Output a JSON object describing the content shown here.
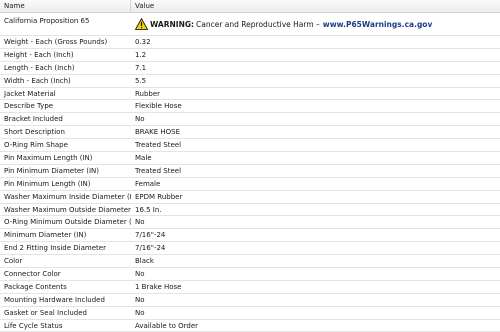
{
  "header": {
    "name": "Name",
    "value": "Value"
  },
  "prop65": {
    "name": "California Proposition 65",
    "warning_label": "WARNING:",
    "warning_text": "Cancer and Reproductive Harm –",
    "warning_link": "www.P65Warnings.ca.gov"
  },
  "rows": [
    {
      "name": "Weight - Each (Gross Pounds)",
      "value": "0.32"
    },
    {
      "name": "Height - Each (Inch)",
      "value": "1.2"
    },
    {
      "name": "Length - Each (Inch)",
      "value": "7.1"
    },
    {
      "name": "Width - Each (Inch)",
      "value": "5.5"
    },
    {
      "name": "Jacket Material",
      "value": "Rubber"
    },
    {
      "name": "Describe Type",
      "value": "Flexible Hose"
    },
    {
      "name": "Bracket Included",
      "value": "No"
    },
    {
      "name": "Short Description",
      "value": "BRAKE HOSE"
    },
    {
      "name": "O-Ring Rim Shape",
      "value": "Treated Steel"
    },
    {
      "name": "Pin Maximum Length (IN)",
      "value": "Male"
    },
    {
      "name": "Pin Minimum Diameter (IN)",
      "value": "Treated Steel"
    },
    {
      "name": "Pin Minimum Length (IN)",
      "value": "Female"
    },
    {
      "name": "Washer Maximum Inside Diameter (I...",
      "value": "EPDM Rubber"
    },
    {
      "name": "Washer Maximum Outside Diameter ...",
      "value": "16.5 In."
    },
    {
      "name": "O-Ring Minimum Outside Diameter (...",
      "value": "No"
    },
    {
      "name": "Minimum Diameter (IN)",
      "value": "7/16\"-24"
    },
    {
      "name": "End 2 Fitting Inside Diameter",
      "value": "7/16\"-24"
    },
    {
      "name": "Color",
      "value": "Black"
    },
    {
      "name": "Connector Color",
      "value": "No"
    },
    {
      "name": "Package Contents",
      "value": "1 Brake Hose"
    },
    {
      "name": "Mounting Hardware Included",
      "value": "No"
    },
    {
      "name": "Gasket or Seal Included",
      "value": "No"
    },
    {
      "name": "Life Cycle Status",
      "value": "Available to Order"
    }
  ],
  "icons": {
    "warning": "warning-triangle-icon"
  },
  "colors": {
    "link": "#1d3d87",
    "warning_yellow": "#f5d400"
  }
}
